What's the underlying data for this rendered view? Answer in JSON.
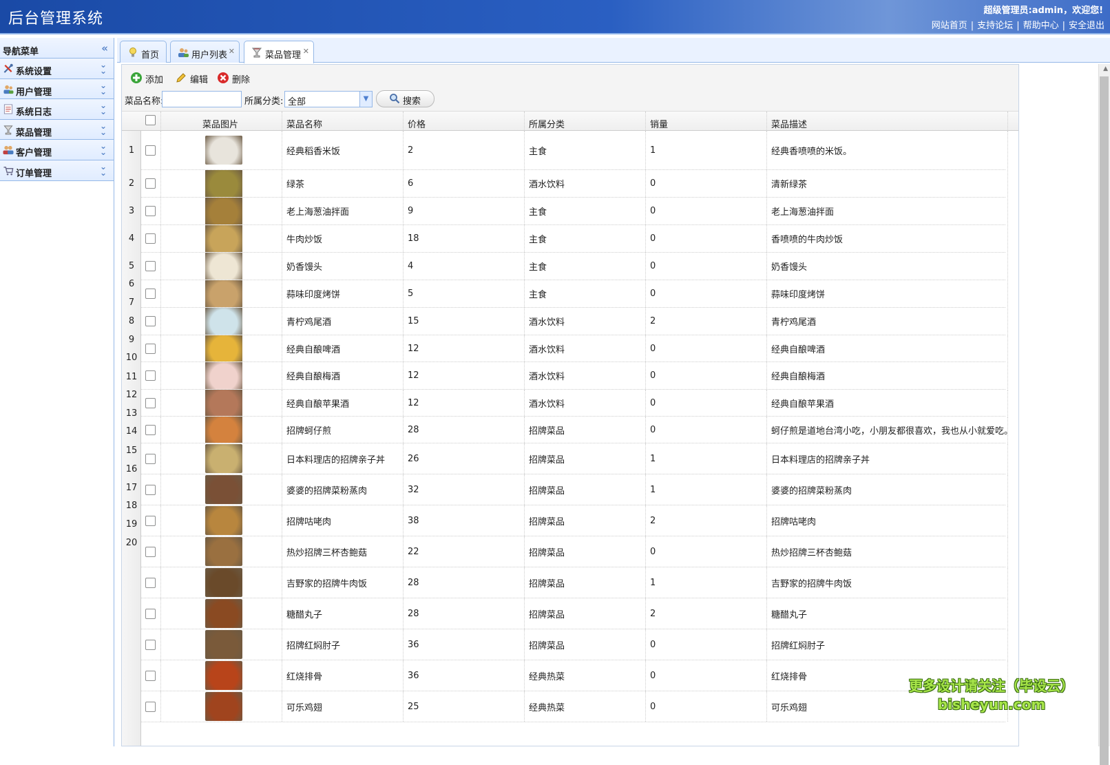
{
  "header": {
    "title": "后台管理系统",
    "welcome": "超级管理员:admin，欢迎您!",
    "links": [
      "网站首页",
      "支持论坛",
      "帮助中心",
      "安全退出"
    ]
  },
  "sidebar": {
    "title": "导航菜单",
    "items": [
      {
        "label": "系统设置",
        "icon": "tools-icon"
      },
      {
        "label": "用户管理",
        "icon": "users-icon"
      },
      {
        "label": "系统日志",
        "icon": "log-icon"
      },
      {
        "label": "菜品管理",
        "icon": "cup-icon"
      },
      {
        "label": "客户管理",
        "icon": "customers-icon"
      },
      {
        "label": "订单管理",
        "icon": "cart-icon"
      }
    ]
  },
  "tabs": [
    {
      "label": "首页",
      "icon": "bulb-icon",
      "closable": false
    },
    {
      "label": "用户列表",
      "icon": "users-icon",
      "closable": true
    },
    {
      "label": "菜品管理",
      "icon": "cup-icon",
      "closable": true,
      "active": true
    }
  ],
  "toolbar": {
    "add": "添加",
    "edit": "编辑",
    "delete": "删除"
  },
  "filters": {
    "name_label": "菜品名称:",
    "name_value": "",
    "category_label": "所属分类:",
    "category_value": "全部",
    "search": "搜索"
  },
  "table": {
    "columns": [
      "菜品图片",
      "菜品名称",
      "价格",
      "所属分类",
      "销量",
      "菜品描述"
    ],
    "row_numbers": [
      "1",
      "2",
      "3",
      "4",
      "5",
      "6",
      "7",
      "8",
      "9",
      "10",
      "11",
      "12",
      "13",
      "14",
      "15",
      "16",
      "17",
      "18",
      "19",
      "20"
    ],
    "rows": [
      {
        "name": "经典稻香米饭",
        "price": "2",
        "category": "主食",
        "sales": "1",
        "desc": "经典香喷喷的米饭。",
        "img": "#e8e4dc"
      },
      {
        "name": "绿茶",
        "price": "6",
        "category": "酒水饮料",
        "sales": "0",
        "desc": "清新绿茶",
        "img": "#9a8a3c"
      },
      {
        "name": "老上海葱油拌面",
        "price": "9",
        "category": "主食",
        "sales": "0",
        "desc": "老上海葱油拌面",
        "img": "#a5803a"
      },
      {
        "name": "牛肉炒饭",
        "price": "18",
        "category": "主食",
        "sales": "0",
        "desc": "香喷喷的牛肉炒饭",
        "img": "#c8a45a"
      },
      {
        "name": "奶香馒头",
        "price": "4",
        "category": "主食",
        "sales": "0",
        "desc": "奶香馒头",
        "img": "#eee6d4"
      },
      {
        "name": "蒜味印度烤饼",
        "price": "5",
        "category": "主食",
        "sales": "0",
        "desc": "蒜味印度烤饼",
        "img": "#c9a26b"
      },
      {
        "name": "青柠鸡尾酒",
        "price": "15",
        "category": "酒水饮料",
        "sales": "2",
        "desc": "青柠鸡尾酒",
        "img": "#cfe3ea"
      },
      {
        "name": "经典自酿啤酒",
        "price": "12",
        "category": "酒水饮料",
        "sales": "0",
        "desc": "经典自酿啤酒",
        "img": "#e6b43a"
      },
      {
        "name": "经典自酿梅酒",
        "price": "12",
        "category": "酒水饮料",
        "sales": "0",
        "desc": "经典自酿梅酒",
        "img": "#f0d2cc"
      },
      {
        "name": "经典自酿苹果酒",
        "price": "12",
        "category": "酒水饮料",
        "sales": "0",
        "desc": "经典自酿苹果酒",
        "img": "#b4785a"
      },
      {
        "name": "招牌蚵仔煎",
        "price": "28",
        "category": "招牌菜品",
        "sales": "0",
        "desc": "蚵仔煎是道地台湾小吃，小朋友都很喜欢，我也从小就爱吃。",
        "img": "#d4823e"
      },
      {
        "name": "日本料理店的招牌亲子丼",
        "price": "26",
        "category": "招牌菜品",
        "sales": "1",
        "desc": "日本料理店的招牌亲子丼",
        "img": "#c9b070"
      },
      {
        "name": "婆婆的招牌菜粉蒸肉",
        "price": "32",
        "category": "招牌菜品",
        "sales": "1",
        "desc": "婆婆的招牌菜粉蒸肉",
        "img": "#7a5036"
      },
      {
        "name": "招牌咕咾肉",
        "price": "38",
        "category": "招牌菜品",
        "sales": "2",
        "desc": "招牌咕咾肉",
        "img": "#b8863e"
      },
      {
        "name": "热炒招牌三杯杏鲍菇",
        "price": "22",
        "category": "招牌菜品",
        "sales": "0",
        "desc": "热炒招牌三杯杏鲍菇",
        "img": "#9a7040"
      },
      {
        "name": "吉野家的招牌牛肉饭",
        "price": "28",
        "category": "招牌菜品",
        "sales": "1",
        "desc": "吉野家的招牌牛肉饭",
        "img": "#6a4a2a"
      },
      {
        "name": "糖醋丸子",
        "price": "28",
        "category": "招牌菜品",
        "sales": "2",
        "desc": "糖醋丸子",
        "img": "#8a4a22"
      },
      {
        "name": "招牌红焖肘子",
        "price": "36",
        "category": "招牌菜品",
        "sales": "0",
        "desc": "招牌红焖肘子",
        "img": "#7a5a3a"
      },
      {
        "name": "红烧排骨",
        "price": "36",
        "category": "经典热菜",
        "sales": "0",
        "desc": "红烧排骨",
        "img": "#b8441a"
      },
      {
        "name": "可乐鸡翅",
        "price": "25",
        "category": "经典热菜",
        "sales": "0",
        "desc": "可乐鸡翅",
        "img": "#a0441e"
      }
    ]
  },
  "watermark": {
    "line1": "更多设计请关注（毕设云）",
    "line2": "bisheyun.com"
  }
}
